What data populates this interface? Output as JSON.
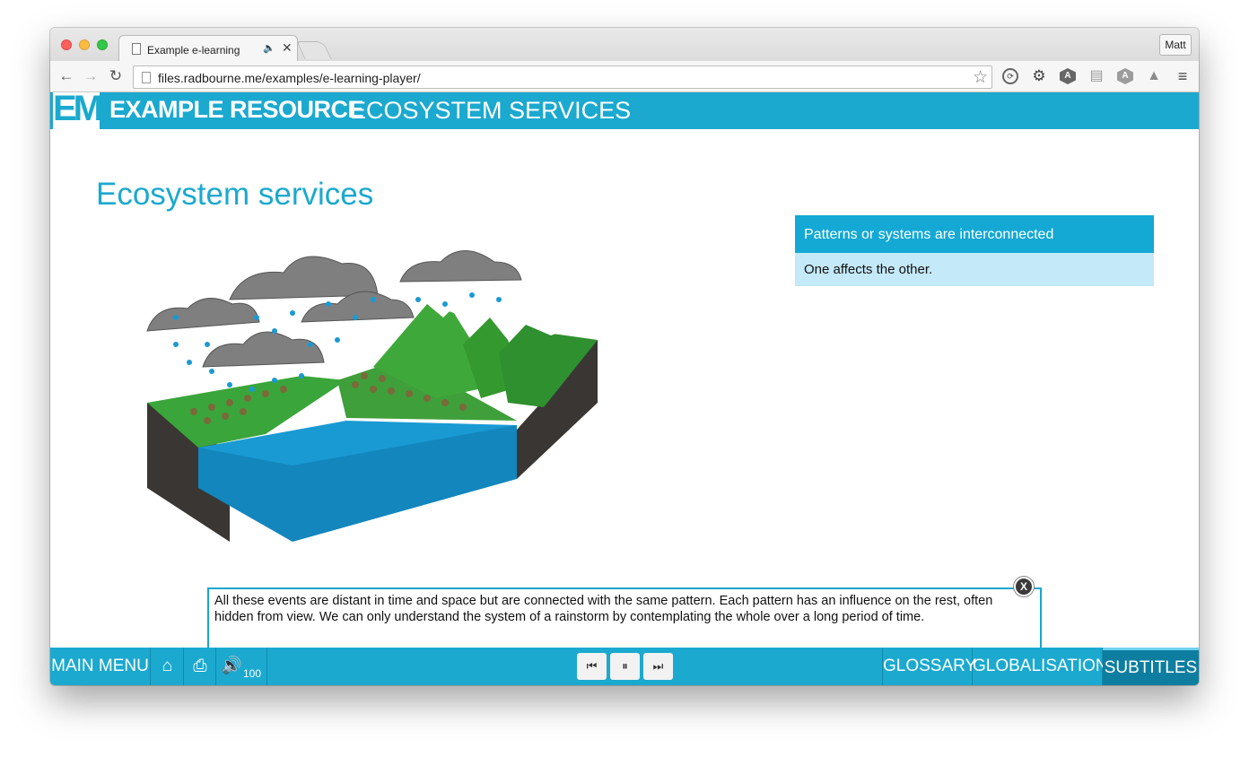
{
  "browser": {
    "tab_title": "Example e-learning",
    "url": "files.radbourne.me/examples/e-learning-player/",
    "profile_name": "Matt"
  },
  "header": {
    "logo_text": "EM",
    "title": "EXAMPLE RESOURCE",
    "subtitle": "ECOSYSTEM SERVICES"
  },
  "slide": {
    "title": "Ecosystem services",
    "info_box": {
      "heading": "Patterns or systems are interconnected",
      "body": "One affects the other."
    },
    "subtitle_text": "All these events are distant in time and space but are connected with the same pattern. Each pattern has an influence on the rest, often hidden from view. We can only understand the system of a rainstorm by contemplating the whole over a long period of time.",
    "subtitle_close": "X"
  },
  "footer": {
    "main_menu": "MAIN MENU",
    "volume": "100",
    "glossary": "GLOSSARY",
    "globalisation": "GLOBALISATION",
    "subtitles": "SUBTITLES"
  },
  "colors": {
    "accent": "#1ba9cf",
    "info_body": "#c4e9f8",
    "subtitles_active": "#0d7e9f"
  }
}
